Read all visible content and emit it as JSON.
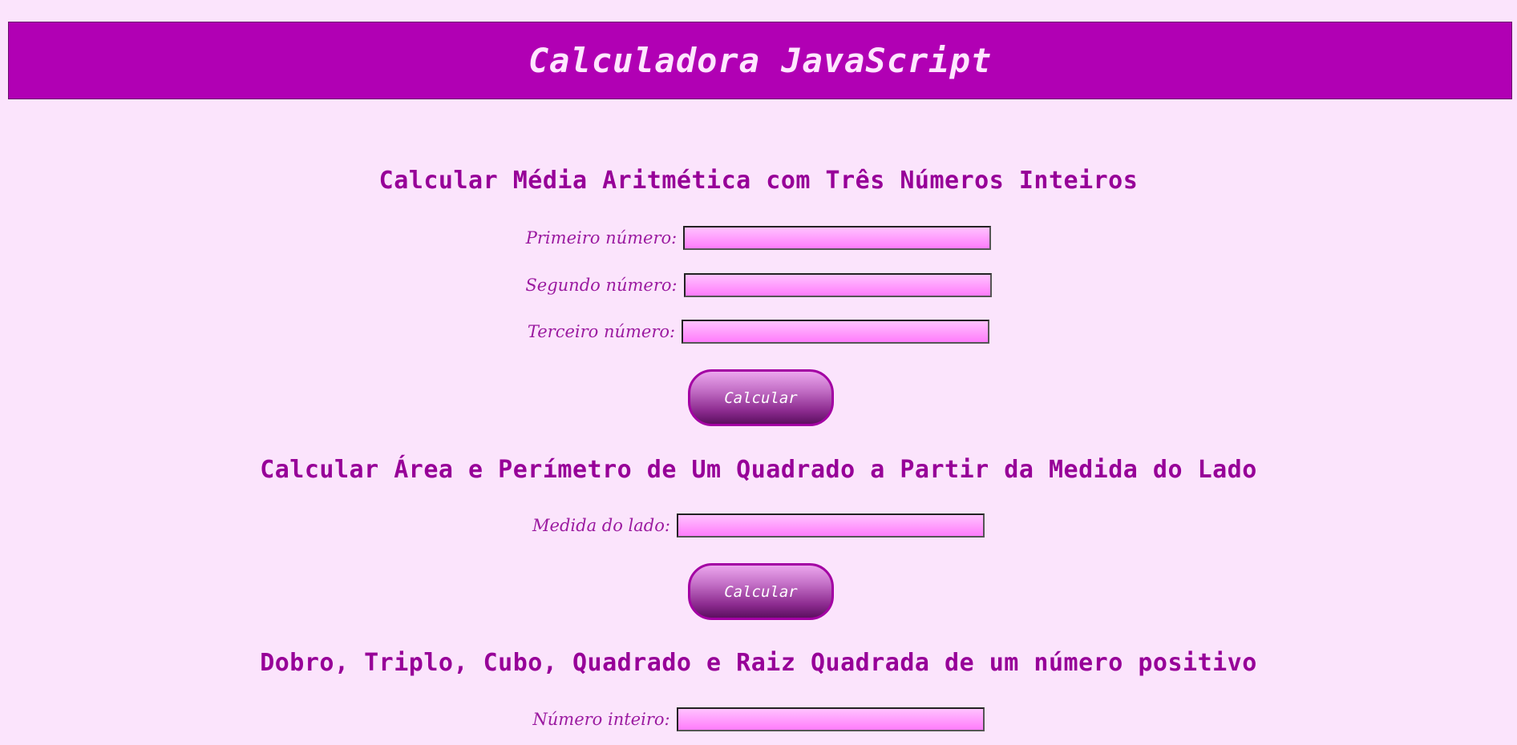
{
  "header": {
    "title": "Calculadora JavaScript"
  },
  "media": {
    "title": "Calcular Média Aritmética com Três Números Inteiros",
    "fields": [
      {
        "label": "Primeiro número:",
        "value": ""
      },
      {
        "label": "Segundo número:",
        "value": ""
      },
      {
        "label": "Terceiro número:",
        "value": ""
      }
    ],
    "button_label": "Calcular"
  },
  "quadrado": {
    "title": "Calcular Área e Perímetro de Um Quadrado a Partir da Medida do Lado",
    "fields": [
      {
        "label": "Medida do lado:",
        "value": ""
      }
    ],
    "button_label": "Calcular"
  },
  "operacoes": {
    "title": "Dobro, Triplo, Cubo, Quadrado e Raiz Quadrada de um número positivo",
    "fields": [
      {
        "label": "Número inteiro:",
        "value": ""
      }
    ]
  }
}
